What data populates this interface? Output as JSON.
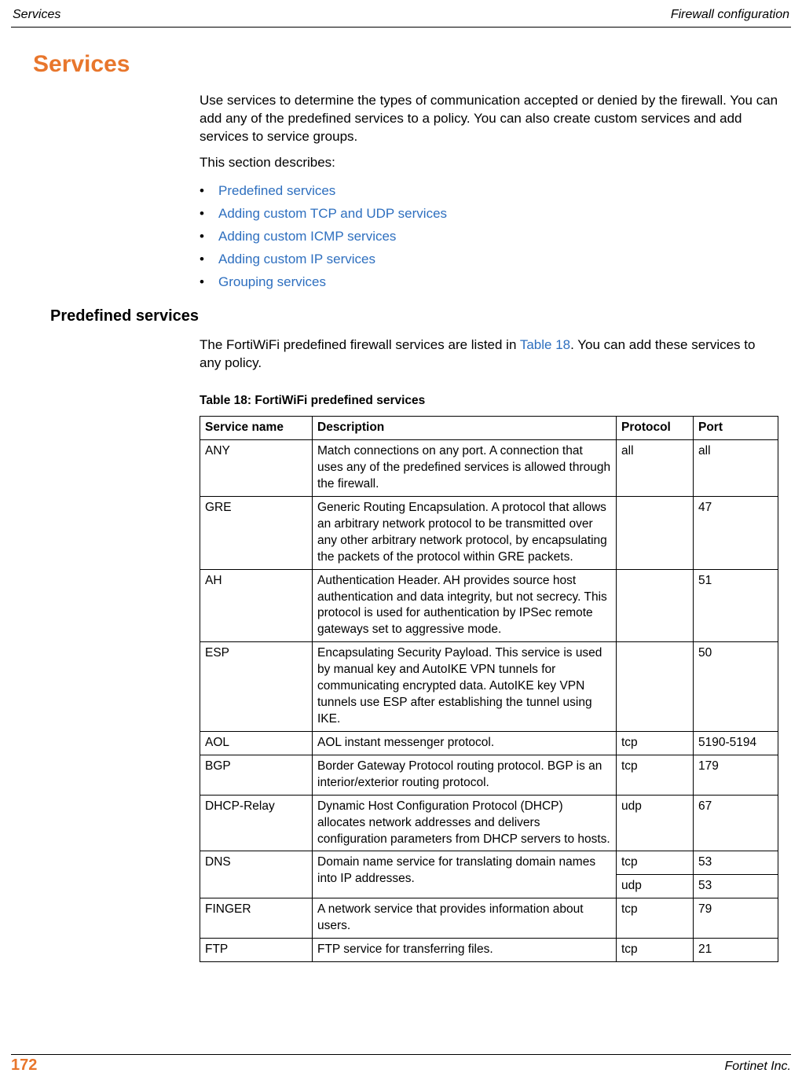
{
  "running_head": {
    "left": "Services",
    "right": "Firewall configuration"
  },
  "section_title": "Services",
  "intro": {
    "p1": "Use services to determine the types of communication accepted or denied by the firewall. You can add any of the predefined services to a policy. You can also create custom services and add services to service groups.",
    "p2": "This section describes:"
  },
  "toc_links": [
    "Predefined services",
    "Adding custom TCP and UDP services",
    "Adding custom ICMP services",
    "Adding custom IP services",
    "Grouping services"
  ],
  "subsection_title": "Predefined services",
  "subsection_text_pre": "The FortiWiFi predefined firewall services are listed in ",
  "subsection_link": "Table 18",
  "subsection_text_post": ". You can add these services to any policy.",
  "table": {
    "caption": "Table 18: FortiWiFi predefined services",
    "headers": {
      "name": "Service name",
      "desc": "Description",
      "proto": "Protocol",
      "port": "Port"
    },
    "rows": [
      {
        "name": "ANY",
        "desc": "Match connections on any port. A connection that uses any of the predefined services is allowed through the firewall.",
        "proto": "all",
        "port": "all"
      },
      {
        "name": "GRE",
        "desc": "Generic Routing Encapsulation. A protocol that allows an arbitrary network protocol to be transmitted over any other arbitrary network protocol, by encapsulating the packets of the protocol within GRE packets.",
        "proto": "",
        "port": "47"
      },
      {
        "name": "AH",
        "desc": "Authentication Header. AH provides source host authentication and data integrity, but not secrecy. This protocol is used for authentication by IPSec remote gateways set to aggressive mode.",
        "proto": "",
        "port": "51"
      },
      {
        "name": "ESP",
        "desc": "Encapsulating Security Payload. This service is used by manual key and AutoIKE VPN tunnels for communicating encrypted data. AutoIKE key VPN tunnels use ESP after establishing the tunnel using IKE.",
        "proto": "",
        "port": "50"
      },
      {
        "name": "AOL",
        "desc": "AOL instant messenger protocol.",
        "proto": "tcp",
        "port": "5190-5194"
      },
      {
        "name": "BGP",
        "desc": "Border Gateway Protocol routing protocol. BGP is an interior/exterior routing protocol.",
        "proto": "tcp",
        "port": "179"
      },
      {
        "name": "DHCP-Relay",
        "desc": "Dynamic Host Configuration Protocol (DHCP) allocates network addresses and delivers configuration parameters from DHCP servers to hosts.",
        "proto": "udp",
        "port": "67"
      },
      {
        "name": "DNS",
        "desc": "Domain name service for translating domain names into IP addresses.",
        "proto": "tcp",
        "port": "53",
        "proto2": "udp",
        "port2": "53"
      },
      {
        "name": "FINGER",
        "desc": "A network service that provides information about users.",
        "proto": "tcp",
        "port": "79"
      },
      {
        "name": "FTP",
        "desc": "FTP service for transferring files.",
        "proto": "tcp",
        "port": "21"
      }
    ]
  },
  "footer": {
    "page": "172",
    "right": "Fortinet Inc."
  }
}
